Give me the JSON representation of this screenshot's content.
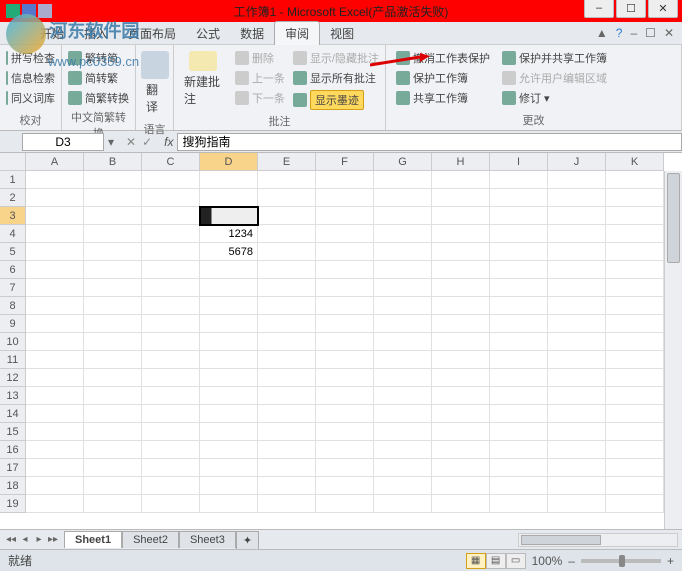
{
  "title": "工作簿1 - Microsoft Excel(产品激活失败)",
  "watermark": {
    "text1": "河东软件园",
    "text2": "www.pc0359.cn"
  },
  "menu": {
    "items": [
      "开始",
      "插入",
      "页面布局",
      "公式",
      "数据",
      "审阅",
      "视图"
    ],
    "active_index": 5
  },
  "ribbon": {
    "group1": {
      "label": "校对",
      "b1": "拼写检查",
      "b2": "信息检索",
      "b3": "同义词库"
    },
    "group2": {
      "label": "中文简繁转换",
      "b1": "繁转简",
      "b2": "简转繁",
      "b3": "简繁转换"
    },
    "group3": {
      "label": "语言",
      "b1": "翻译"
    },
    "group4": {
      "label": "批注",
      "new": "新建批注",
      "del": "删除",
      "prev": "上一条",
      "next": "下一条",
      "show1": "显示/隐藏批注",
      "show2": "显示所有批注",
      "ink": "显示墨迹"
    },
    "group5": {
      "label": "更改",
      "b1": "撤消工作表保护",
      "b2": "保护工作簿",
      "b3": "共享工作簿",
      "b4": "保护并共享工作簿",
      "b5": "允许用户编辑区域",
      "b6": "修订"
    }
  },
  "namebox": "D3",
  "formula": "搜狗指南",
  "columns": [
    "A",
    "B",
    "C",
    "D",
    "E",
    "F",
    "G",
    "H",
    "I",
    "J",
    "K"
  ],
  "rows": [
    1,
    2,
    3,
    4,
    5,
    6,
    7,
    8,
    9,
    10,
    11,
    12,
    13,
    14,
    15,
    16,
    17,
    18,
    19
  ],
  "data": {
    "d4": "1234",
    "d5": "5678"
  },
  "sheets": [
    "Sheet1",
    "Sheet2",
    "Sheet3"
  ],
  "status": "就绪",
  "zoom": "100%"
}
